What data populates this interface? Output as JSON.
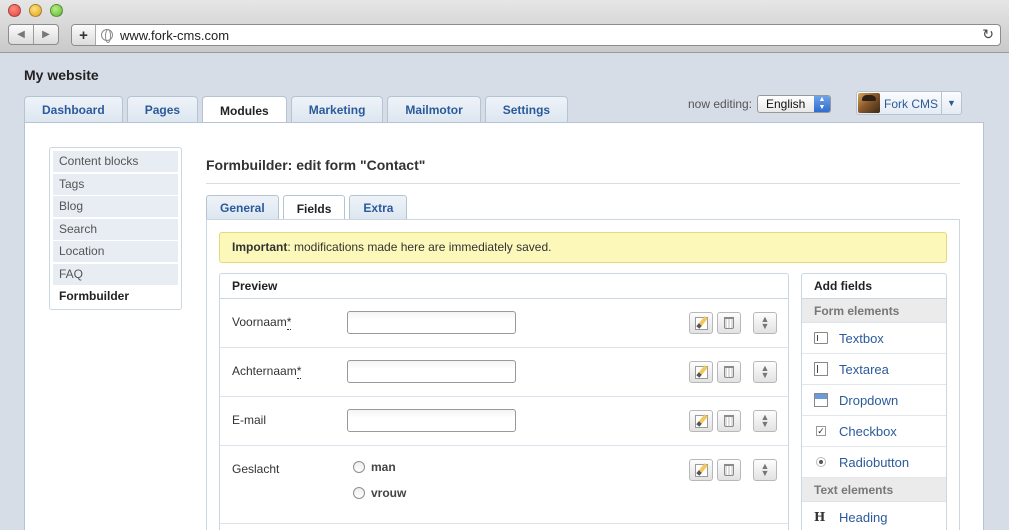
{
  "browser": {
    "url": "www.fork-cms.com",
    "new_tab_label": "+",
    "back_glyph": "◀",
    "forward_glyph": "▶",
    "reload_glyph": "↻"
  },
  "app": {
    "site_title": "My website",
    "tabs": [
      {
        "label": "Dashboard"
      },
      {
        "label": "Pages"
      },
      {
        "label": "Modules",
        "active": true
      },
      {
        "label": "Marketing"
      },
      {
        "label": "Mailmotor"
      },
      {
        "label": "Settings"
      }
    ],
    "now_editing_label": "now editing:",
    "language": "English",
    "user_name": "Fork CMS",
    "user_caret": "▼"
  },
  "sidebar": {
    "items": [
      {
        "label": "Content blocks"
      },
      {
        "label": "Tags"
      },
      {
        "label": "Blog"
      },
      {
        "label": "Search"
      },
      {
        "label": "Location"
      },
      {
        "label": "FAQ"
      },
      {
        "label": "Formbuilder",
        "active": true
      }
    ]
  },
  "main": {
    "title": "Formbuilder: edit form \"Contact\"",
    "subtabs": [
      {
        "label": "General"
      },
      {
        "label": "Fields",
        "active": true
      },
      {
        "label": "Extra"
      }
    ],
    "notice": {
      "strong": "Important",
      "text": ": modifications made here are immediately saved."
    },
    "preview": {
      "heading": "Preview",
      "fields": [
        {
          "label": "Voornaam",
          "required": "*",
          "type": "textbox"
        },
        {
          "label": "Achternaam",
          "required": "*",
          "type": "textbox"
        },
        {
          "label": "E-mail",
          "required": "",
          "type": "textbox"
        },
        {
          "label": "Geslacht",
          "required": "",
          "type": "radio",
          "options": [
            "man",
            "vrouw"
          ]
        }
      ]
    },
    "add_fields": {
      "heading": "Add fields",
      "form_elements_label": "Form elements",
      "form_elements": [
        {
          "label": "Textbox",
          "icon": "textbox-icon"
        },
        {
          "label": "Textarea",
          "icon": "textarea-icon"
        },
        {
          "label": "Dropdown",
          "icon": "dropdown-icon"
        },
        {
          "label": "Checkbox",
          "icon": "checkbox-icon"
        },
        {
          "label": "Radiobutton",
          "icon": "radiobutton-icon"
        }
      ],
      "text_elements_label": "Text elements",
      "text_elements": [
        {
          "label": "Heading",
          "icon": "heading-icon",
          "glyph": "H"
        }
      ]
    }
  },
  "colors": {
    "link": "#2b5a9b",
    "notice_bg": "#fbf8b9",
    "panel_border": "#b5c4d3"
  }
}
